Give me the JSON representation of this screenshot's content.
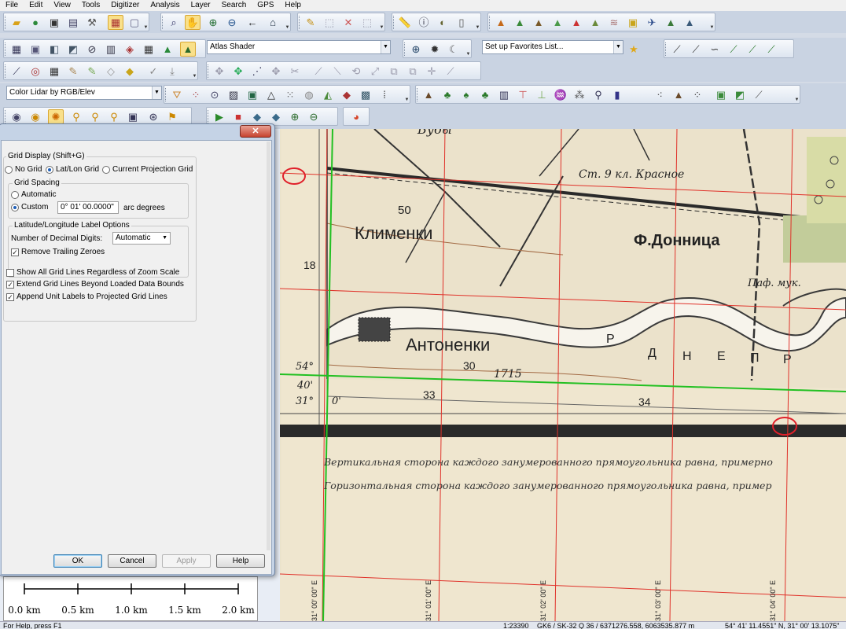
{
  "menu": [
    "File",
    "Edit",
    "View",
    "Tools",
    "Digitizer",
    "Analysis",
    "Layer",
    "Search",
    "GPS",
    "Help"
  ],
  "toolbar": {
    "shader_combo": "Atlas Shader",
    "favorites_combo": "Set up Favorites List...",
    "lidar_combo": "Color Lidar by RGB/Elev"
  },
  "dialog": {
    "grid_display_title": "Grid Display (Shift+G)",
    "radio_no_grid": "No Grid",
    "radio_latlon": "Lat/Lon Grid",
    "radio_projection": "Current Projection Grid",
    "spacing_title": "Grid Spacing",
    "spacing_automatic": "Automatic",
    "spacing_custom": "Custom",
    "spacing_value": "0° 01' 00.0000\"",
    "spacing_unit": "arc degrees",
    "label_options_title": "Latitude/Longitude Label Options",
    "decimal_digits_label": "Number of Decimal Digits:",
    "decimal_digits_value": "Automatic",
    "remove_trailing_zeroes": "Remove Trailing Zeroes",
    "show_all_lines": "Show All Grid Lines Regardless of Zoom Scale",
    "extend_lines": "Extend Grid Lines Beyond Loaded Data Bounds",
    "append_unit_labels": "Append Unit Labels to Projected Grid Lines",
    "ok": "OK",
    "cancel": "Cancel",
    "apply": "Apply",
    "help": "Help",
    "close": "✕"
  },
  "scalebar": {
    "labels": [
      "0.0 km",
      "0.5 km",
      "1.0 km",
      "1.5 km",
      "2.0 km"
    ]
  },
  "map": {
    "place_labels": [
      "Климeнки",
      "Антоненки",
      "Ф.Донница",
      "Ст. 9 кл. Красное",
      "Бубы",
      "Паф. мук."
    ],
    "numbers": [
      "50",
      "30",
      "1715",
      "18",
      "33",
      "34"
    ],
    "margin_labels": [
      "54°",
      "40'",
      "31°",
      "0'"
    ],
    "river_letters": [
      "Р",
      "Д",
      "Н",
      "Е",
      "П",
      "Р"
    ],
    "legend_line1": "Вертикальная сторона каждого занумерованного прямоугольника равна, примерно",
    "legend_line2": "Горизонтальная сторона каждого занумерованного прямоугольника равна, пример",
    "grid_labels": [
      "31° 00' 00\" E",
      "31° 01' 00\" E",
      "31° 02' 00\" E",
      "31° 03' 00\" E",
      "31° 04' 00\" E"
    ]
  },
  "statusbar": {
    "help_hint": "For Help, press F1",
    "scale": "1:23390",
    "projection": "GK6 / SK-32 Q 36 / 6371276.558, 6063535.877 m",
    "coords": "54° 41' 11.4551\" N, 31° 00' 13.1075\""
  }
}
